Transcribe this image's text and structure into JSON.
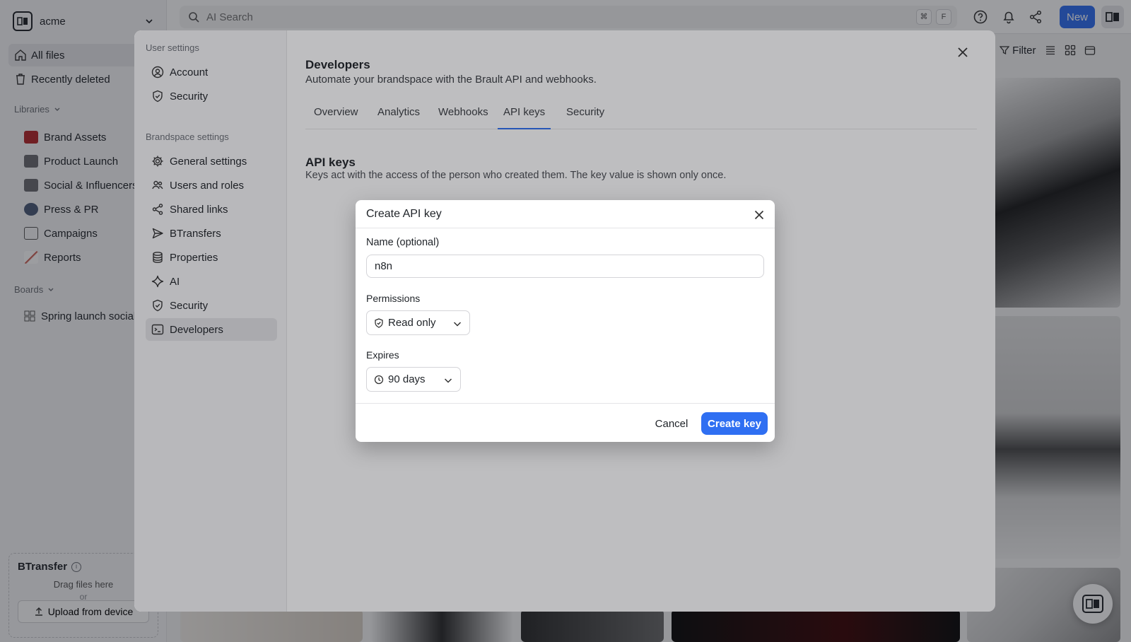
{
  "app": {
    "workspace_name": "acme",
    "search_placeholder": "AI Search",
    "shortcut_keys": [
      "⌘",
      "F"
    ],
    "new_button": "New",
    "accent_color": "#2f6ff2"
  },
  "sidebar": {
    "all_files": "All files",
    "recently_deleted": "Recently deleted",
    "libraries_heading": "Libraries",
    "libraries": [
      {
        "label": "Brand Assets",
        "color": "#b3262a"
      },
      {
        "label": "Product Launch",
        "color": "#6b6b70"
      },
      {
        "label": "Social & Influencers",
        "color": "#6b6b70"
      },
      {
        "label": "Press & PR",
        "color": "#4a5a78"
      },
      {
        "label": "Campaigns",
        "color": "#777777"
      },
      {
        "label": "Reports",
        "color": "#c0392b"
      }
    ],
    "boards_heading": "Boards",
    "boards": [
      {
        "label": "Spring launch social"
      }
    ],
    "btransfer": {
      "title": "BTransfer",
      "drag_text": "Drag files here",
      "or_text": "or",
      "upload_button": "Upload from device"
    }
  },
  "view_toolbar": {
    "partial_text": "t",
    "filter_label": "Filter"
  },
  "settings": {
    "user_settings_heading": "User settings",
    "user_items": [
      {
        "label": "Account",
        "icon": "user-circle-icon"
      },
      {
        "label": "Security",
        "icon": "shield-check-icon"
      }
    ],
    "brandspace_heading": "Brandspace settings",
    "brandspace_items": [
      {
        "label": "General settings",
        "icon": "gear-icon"
      },
      {
        "label": "Users and roles",
        "icon": "users-icon"
      },
      {
        "label": "Shared links",
        "icon": "share-icon"
      },
      {
        "label": "BTransfers",
        "icon": "send-icon"
      },
      {
        "label": "Properties",
        "icon": "database-icon"
      },
      {
        "label": "AI",
        "icon": "sparkle-icon"
      },
      {
        "label": "Security",
        "icon": "shield-check-icon"
      },
      {
        "label": "Developers",
        "icon": "terminal-icon",
        "active": true
      }
    ],
    "developers": {
      "title": "Developers",
      "subtitle": "Automate your brandspace with the Brault API and webhooks.",
      "tabs": [
        "Overview",
        "Analytics",
        "Webhooks",
        "API keys",
        "Security"
      ],
      "active_tab": "API keys",
      "section_title": "API keys",
      "section_subtitle": "Keys act with the access of the person who created them. The key value is shown only once."
    }
  },
  "dialog": {
    "title": "Create API key",
    "name_label": "Name (optional)",
    "name_value": "n8n",
    "permissions_label": "Permissions",
    "permissions_value": "Read only",
    "expires_label": "Expires",
    "expires_value": "90 days",
    "cancel_button": "Cancel",
    "create_button": "Create key"
  }
}
